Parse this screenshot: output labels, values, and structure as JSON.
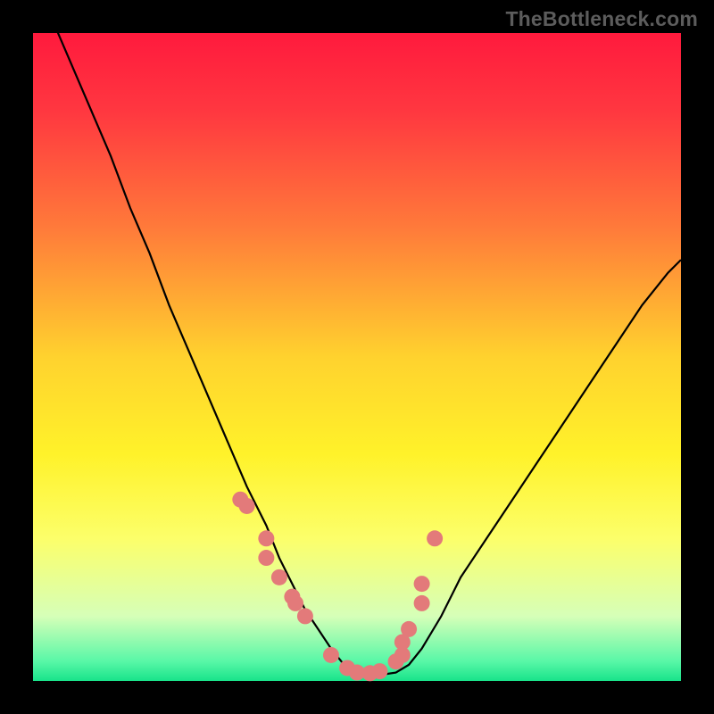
{
  "watermark": {
    "text": "TheBottleneck.com"
  },
  "colors": {
    "frame": "#000000",
    "gradient_stops": [
      {
        "pct": 0,
        "color": "#ff1a3d"
      },
      {
        "pct": 12,
        "color": "#ff3740"
      },
      {
        "pct": 30,
        "color": "#ff7a3a"
      },
      {
        "pct": 50,
        "color": "#ffd22e"
      },
      {
        "pct": 65,
        "color": "#fff22a"
      },
      {
        "pct": 78,
        "color": "#fcff6a"
      },
      {
        "pct": 90,
        "color": "#d6ffb8"
      },
      {
        "pct": 97,
        "color": "#58f7a7"
      },
      {
        "pct": 100,
        "color": "#18e38a"
      }
    ],
    "curve_stroke": "#000000",
    "marker_fill": "#e37a7a",
    "marker_stroke": "#d05a5a"
  },
  "chart_data": {
    "type": "line",
    "title": "",
    "xlabel": "",
    "ylabel": "",
    "xlim": [
      0,
      100
    ],
    "ylim": [
      0,
      100
    ],
    "x": [
      0,
      3,
      6,
      9,
      12,
      15,
      18,
      21,
      24,
      27,
      30,
      33,
      36,
      38,
      40,
      42,
      44,
      46,
      48,
      50,
      52,
      54,
      56,
      58,
      60,
      63,
      66,
      70,
      74,
      78,
      82,
      86,
      90,
      94,
      98,
      100
    ],
    "y": [
      108,
      102,
      95,
      88,
      81,
      73,
      66,
      58,
      51,
      44,
      37,
      30,
      24,
      19,
      15,
      11,
      8,
      5,
      2.5,
      1.3,
      1.0,
      1.0,
      1.3,
      2.5,
      5,
      10,
      16,
      22,
      28,
      34,
      40,
      46,
      52,
      58,
      63,
      65
    ],
    "markers": {
      "x": [
        32,
        33,
        36,
        36,
        38,
        40,
        40.5,
        42,
        46,
        48.5,
        50,
        52,
        53.5,
        56,
        57,
        57,
        58,
        60,
        60,
        62
      ],
      "y": [
        28,
        27,
        22,
        19,
        16,
        13,
        12,
        10,
        4,
        2,
        1.3,
        1.2,
        1.5,
        3,
        4,
        6,
        8,
        12,
        15,
        22
      ]
    }
  }
}
